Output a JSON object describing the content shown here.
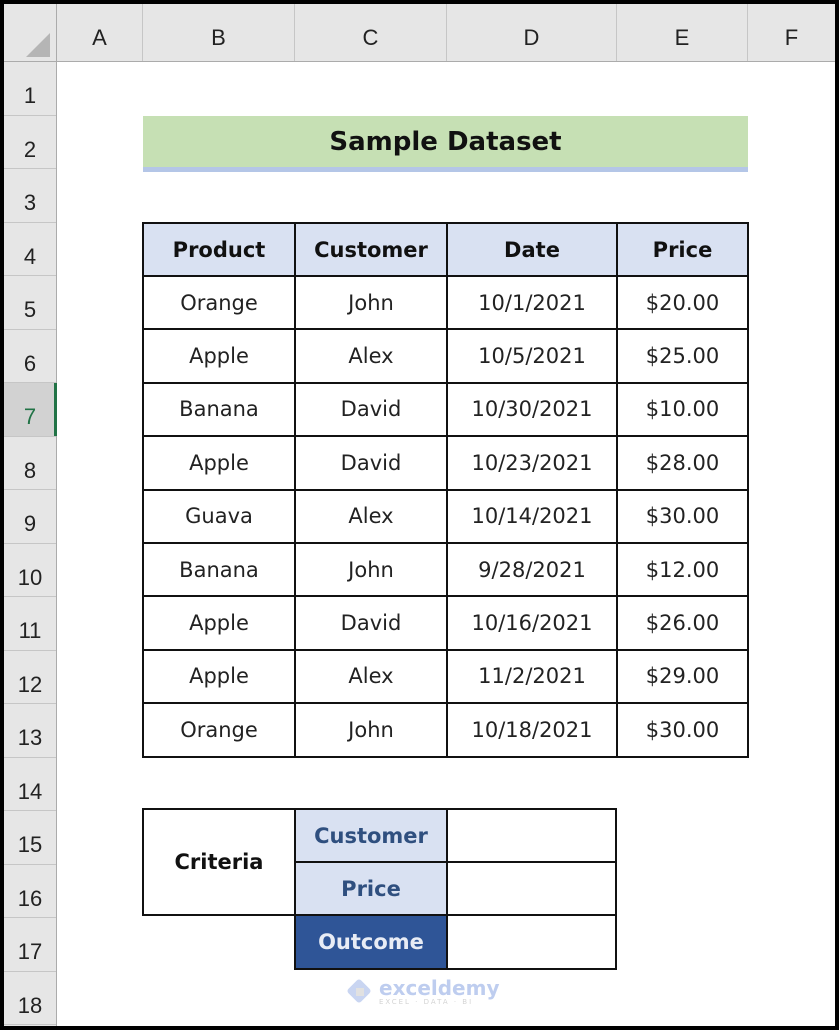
{
  "columns": [
    "A",
    "B",
    "C",
    "D",
    "E",
    "F"
  ],
  "rows": [
    "1",
    "2",
    "3",
    "4",
    "5",
    "6",
    "7",
    "8",
    "9",
    "10",
    "11",
    "12",
    "13",
    "14",
    "15",
    "16",
    "17",
    "18"
  ],
  "active_row": "7",
  "title": "Sample Dataset",
  "table": {
    "headers": [
      "Product",
      "Customer",
      "Date",
      "Price"
    ],
    "rows": [
      [
        "Orange",
        "John",
        "10/1/2021",
        "$20.00"
      ],
      [
        "Apple",
        "Alex",
        "10/5/2021",
        "$25.00"
      ],
      [
        "Banana",
        "David",
        "10/30/2021",
        "$10.00"
      ],
      [
        "Apple",
        "David",
        "10/23/2021",
        "$28.00"
      ],
      [
        "Guava",
        "Alex",
        "10/14/2021",
        "$30.00"
      ],
      [
        "Banana",
        "John",
        "9/28/2021",
        "$12.00"
      ],
      [
        "Apple",
        "David",
        "10/16/2021",
        "$26.00"
      ],
      [
        "Apple",
        "Alex",
        "11/2/2021",
        "$29.00"
      ],
      [
        "Orange",
        "John",
        "10/18/2021",
        "$30.00"
      ]
    ]
  },
  "criteria": {
    "label": "Criteria",
    "customer_label": "Customer",
    "customer_value": "",
    "price_label": "Price",
    "price_value": "",
    "outcome_label": "Outcome",
    "outcome_value": ""
  },
  "watermark": {
    "name": "exceldemy",
    "tagline": "EXCEL · DATA · BI"
  },
  "colors": {
    "title_fill": "#c6e0b4",
    "header_fill": "#d9e1f2",
    "outcome_fill": "#2f5597",
    "active_row_accent": "#217346"
  }
}
